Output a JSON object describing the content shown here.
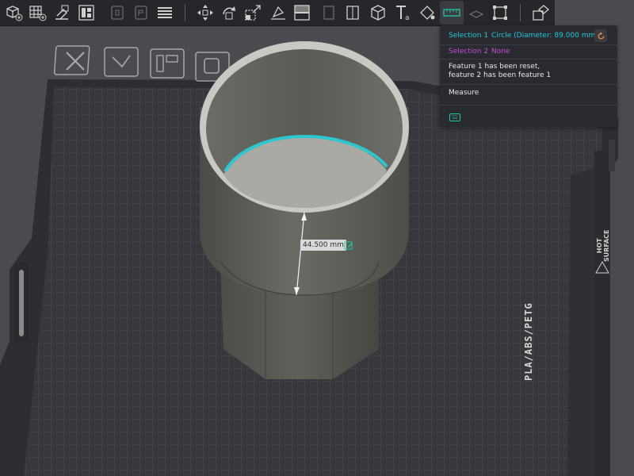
{
  "toolbar": {
    "tools": [
      {
        "name": "add-object"
      },
      {
        "name": "add-plate"
      },
      {
        "name": "orient"
      },
      {
        "name": "arrange"
      },
      {
        "name": "split-objects"
      },
      {
        "name": "split-parts"
      },
      {
        "name": "layers"
      },
      {
        "name": "move"
      },
      {
        "name": "rotate"
      },
      {
        "name": "scale"
      },
      {
        "name": "lay-on-face"
      },
      {
        "name": "cut"
      },
      {
        "name": "support-painting"
      },
      {
        "name": "seam-painting"
      },
      {
        "name": "assembly"
      },
      {
        "name": "text-shape"
      },
      {
        "name": "color-painting"
      },
      {
        "name": "measure"
      },
      {
        "name": "emboss"
      },
      {
        "name": "fit-view"
      },
      {
        "name": "assembly-view"
      }
    ]
  },
  "measure_panel": {
    "selection1_label": "Selection 1",
    "selection1_value": "Circle (Diameter: 89.000 mm)",
    "selection2_label": "Selection 2",
    "selection2_value": "None",
    "message_line1": "Feature 1 has been reset,",
    "message_line2": "feature 2 has been feature 1",
    "section_title": "Measure"
  },
  "dimension": {
    "value": "44.500 mm"
  },
  "build_plate": {
    "material_text": "PLA/ABS/PETG",
    "hot_line1": "HOT",
    "hot_line2": "SURFACE"
  },
  "colors": {
    "accent_selection1": "#21c7d6",
    "accent_selection2": "#c34ad4",
    "panel_bg": "#2a2b30",
    "toolbar_bg": "#26272b",
    "plate_bg": "#3a3a3e"
  }
}
